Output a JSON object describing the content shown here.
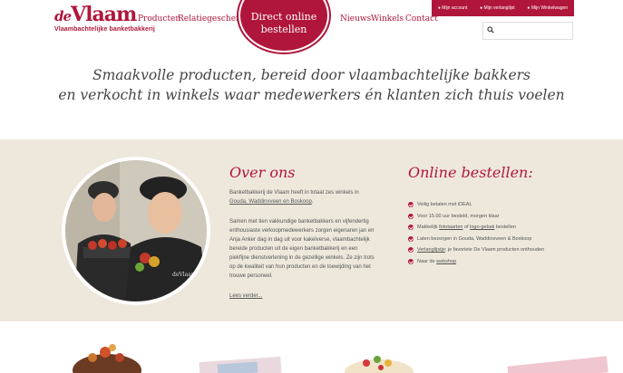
{
  "logo": {
    "prefix": "de",
    "name": "Vlaam",
    "subtitle": "Vlaambachtelijke banketbakkerij"
  },
  "nav": {
    "items": [
      "Producten",
      "Relatiegeschenken",
      "Nieuws",
      "Winkels",
      "Contact"
    ]
  },
  "badge": {
    "line1": "Direct online",
    "line2": "bestellen"
  },
  "topbar": {
    "account": "Mijn account",
    "wishlist": "Mijn verlanglijst",
    "cart": "Mijn Winkelwagen"
  },
  "search": {
    "placeholder": ""
  },
  "tagline": {
    "line1": "Smaakvolle producten, bereid door vlaambachtelijke bakkers",
    "line2": "en verkocht in winkels waar medewerkers én klanten zich thuis voelen"
  },
  "about": {
    "title": "Over ons",
    "p1_text": "Banketbakkerij de Vlaam heeft in totaal zes winkels in",
    "p1_link": "Gouda, Waddinxveen en Boskoop",
    "p2_lines": [
      "Samen met tien vakkundige banketbakkers en vijfendertig",
      "enthousiaste verkoopmedewerkers zorgen eigenaren jan en",
      "Anja Anker dag in dag uit voor kakelverse, vlaambachtelijk",
      "bereide producten uit de eigen banketbakkerij en een",
      "piekfijne dienstverlening in de gezellige winkels. Ze zijn trots",
      "op de kwaliteit van hun producten en de toewijding van het",
      "trouwe personeel."
    ],
    "read_more": "Lees verder..."
  },
  "online": {
    "title": "Online bestellen:",
    "items": [
      {
        "pre": "Veilig betalen met iDEAL",
        "link": "",
        "post": ""
      },
      {
        "pre": "Voor 15.00 uur besteld, morgen klaar",
        "link": "",
        "post": ""
      },
      {
        "pre": "Makkelijk ",
        "link": "fototaarten",
        "mid": " of ",
        "link2": "logo-gebak",
        "post": " bestellen"
      },
      {
        "pre": "Laten bezorgen in Gouda, Waddinxveen & Boskoop",
        "link": "",
        "post": ""
      },
      {
        "pre": "",
        "link": "Verlanglijstje",
        "post": ": je favoriete De Vlaam producten onthouden"
      },
      {
        "pre": "Naar de ",
        "link": "webshop",
        "post": ""
      }
    ]
  },
  "colors": {
    "brand": "#b0163b",
    "beige": "#eee8dc"
  }
}
